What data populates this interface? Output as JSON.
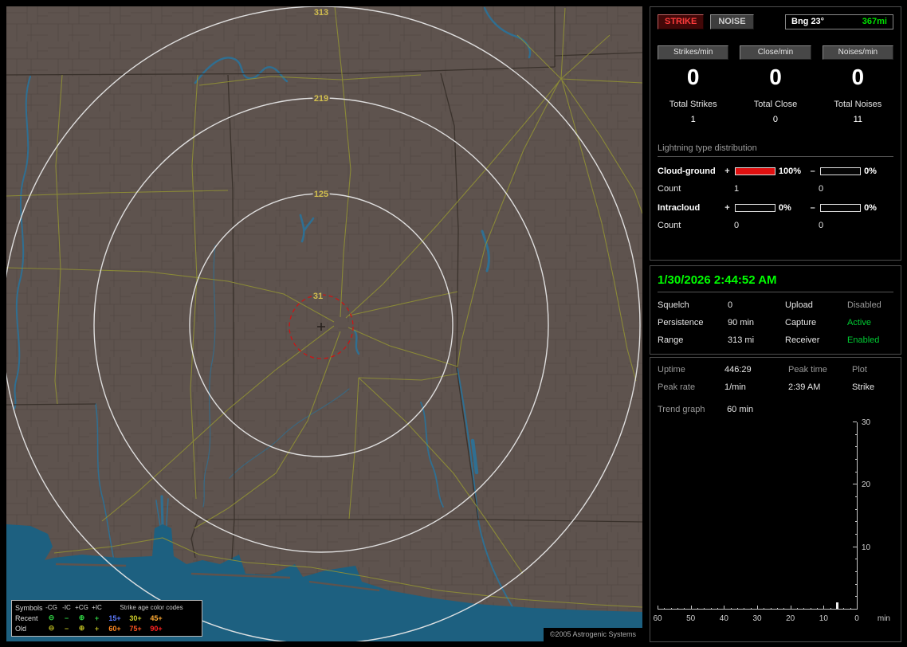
{
  "map": {
    "range_ring_labels": [
      "313",
      "219",
      "125",
      "31"
    ],
    "copyright": "©2005 Astrogenic Systems",
    "legend": {
      "header_symbols": "Symbols",
      "symbol_columns": [
        "-CG",
        "-IC",
        "+CG",
        "+IC"
      ],
      "age_header": "Strike age color codes",
      "rows": [
        {
          "label": "Recent",
          "symbols": [
            "⊖",
            "−",
            "⊕",
            "+"
          ],
          "symbol_color": "#2ecc40",
          "ages": [
            {
              "text": "15+",
              "color": "#5e7bff"
            },
            {
              "text": "30+",
              "color": "#cfcf2a"
            },
            {
              "text": "45+",
              "color": "#ffaa33"
            }
          ]
        },
        {
          "label": "Old",
          "symbols": [
            "⊖",
            "−",
            "⊕",
            "+"
          ],
          "symbol_color": "#b5b520",
          "ages": [
            {
              "text": "60+",
              "color": "#ff8822"
            },
            {
              "text": "75+",
              "color": "#ff5522"
            },
            {
              "text": "90+",
              "color": "#ff2222"
            }
          ]
        }
      ]
    }
  },
  "sidebar": {
    "strike_button": "STRIKE",
    "noise_button": "NOISE",
    "bearing_label": "Bng 23°",
    "bearing_distance": "367mi",
    "counters": [
      {
        "button": "Strikes/min",
        "value": "0",
        "total_label": "Total Strikes",
        "total_value": "1"
      },
      {
        "button": "Close/min",
        "value": "0",
        "total_label": "Total Close",
        "total_value": "0"
      },
      {
        "button": "Noises/min",
        "value": "0",
        "total_label": "Total Noises",
        "total_value": "11"
      }
    ],
    "distribution": {
      "title": "Lightning type distribution",
      "count_label": "Count",
      "bar_color": "#e01010",
      "rows": [
        {
          "name": "Cloud-ground",
          "plus_sign": "+",
          "plus_fill": 100,
          "plus_pct_label": "100%",
          "minus_sign": "–",
          "minus_fill": 0,
          "minus_pct_label": "0%",
          "plus_count": "1",
          "minus_count": "0"
        },
        {
          "name": "Intracloud",
          "plus_sign": "+",
          "plus_fill": 0,
          "plus_pct_label": "0%",
          "minus_sign": "–",
          "minus_fill": 0,
          "minus_pct_label": "0%",
          "plus_count": "0",
          "minus_count": "0"
        }
      ]
    },
    "datetime": "1/30/2026 2:44:52 AM",
    "status_rows": [
      {
        "l1": "Squelch",
        "v1": "0",
        "l2": "Upload",
        "v2": "Disabled",
        "v2_color": "#9a9a9a"
      },
      {
        "l1": "Persistence",
        "v1": "90 min",
        "l2": "Capture",
        "v2": "Active",
        "v2_color": "#00cc33"
      },
      {
        "l1": "Range",
        "v1": "313 mi",
        "l2": "Receiver",
        "v2": "Enabled",
        "v2_color": "#00cc33"
      }
    ],
    "stats": {
      "uptime_label": "Uptime",
      "uptime": "446:29",
      "peak_time_label": "Peak time",
      "plot_label": "Plot",
      "peak_rate_label": "Peak rate",
      "peak_rate": "1/min",
      "peak_time": "2:39 AM",
      "plot_value": "Strike",
      "trend_label": "Trend graph",
      "trend_window": "60 min"
    }
  },
  "chart_data": {
    "type": "bar",
    "title": "Strike trend graph (last 60 min)",
    "xlabel": "min",
    "ylabel": "",
    "x_ticks": [
      60,
      50,
      40,
      30,
      20,
      10,
      0
    ],
    "y_ticks": [
      0,
      10,
      20,
      30
    ],
    "xlim": [
      60,
      0
    ],
    "ylim": [
      0,
      30
    ],
    "grid": false,
    "legend_position": "none",
    "series": [
      {
        "name": "Strike",
        "points": [
          {
            "minutes_ago": 6,
            "value": 1
          }
        ]
      }
    ]
  }
}
